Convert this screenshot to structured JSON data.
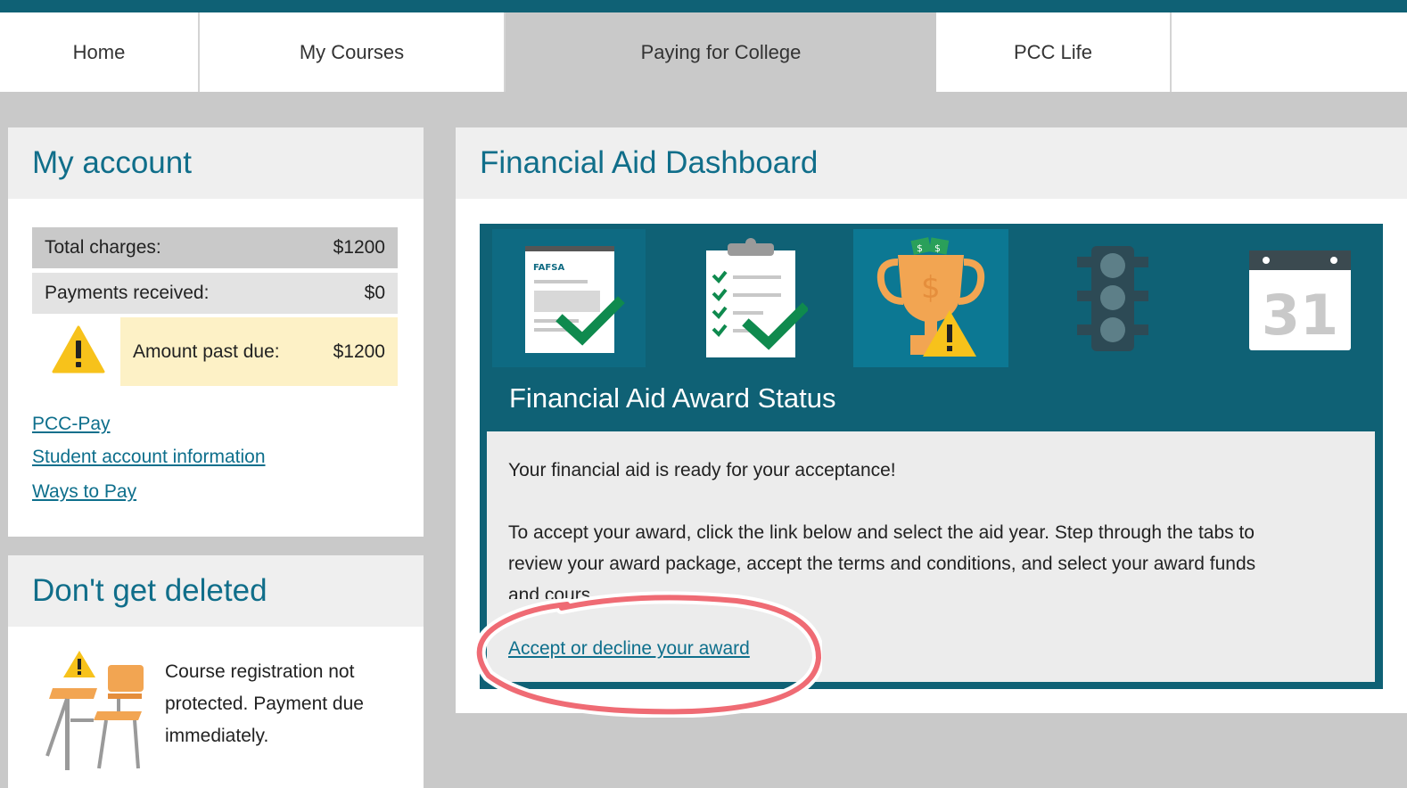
{
  "nav": {
    "tabs": [
      {
        "label": "Home"
      },
      {
        "label": "My Courses"
      },
      {
        "label": "Paying for College"
      },
      {
        "label": "PCC Life"
      },
      {
        "label": ""
      }
    ]
  },
  "account": {
    "title": "My account",
    "rows": [
      {
        "label": "Total charges:",
        "value": "$1200"
      },
      {
        "label": "Payments received:",
        "value": "$0"
      },
      {
        "label": "Amount past due:",
        "value": "$1200"
      }
    ],
    "links": [
      "PCC-Pay",
      "Student account information",
      "Ways to Pay"
    ]
  },
  "deleted": {
    "title": "Don't get deleted",
    "message_lines": [
      "Course registration not",
      "protected. Payment due",
      "immediately."
    ]
  },
  "dashboard": {
    "title": "Financial Aid Dashboard",
    "icons": [
      "fafsa-document-icon",
      "checklist-clipboard-icon",
      "trophy-award-icon",
      "traffic-light-icon",
      "calendar-icon"
    ],
    "fafsa_label": "FAFSA",
    "calendar_day": "31",
    "status_title": "Financial Aid Award Status",
    "ready_text": "Your financial aid is ready for your acceptance!",
    "instructions_line1": "To accept your award, click the link below and select the aid year. Step through the tabs to",
    "instructions_line2": "review your award package, accept the terms and conditions, and select your award funds",
    "instructions_line3": "and cours",
    "accept_link": "Accept or decline your award"
  },
  "colors": {
    "brand_teal": "#0f6175",
    "link": "#0e6f8c",
    "warning_yellow": "#f7c21b",
    "highlight_ring": "#ef6b74"
  }
}
